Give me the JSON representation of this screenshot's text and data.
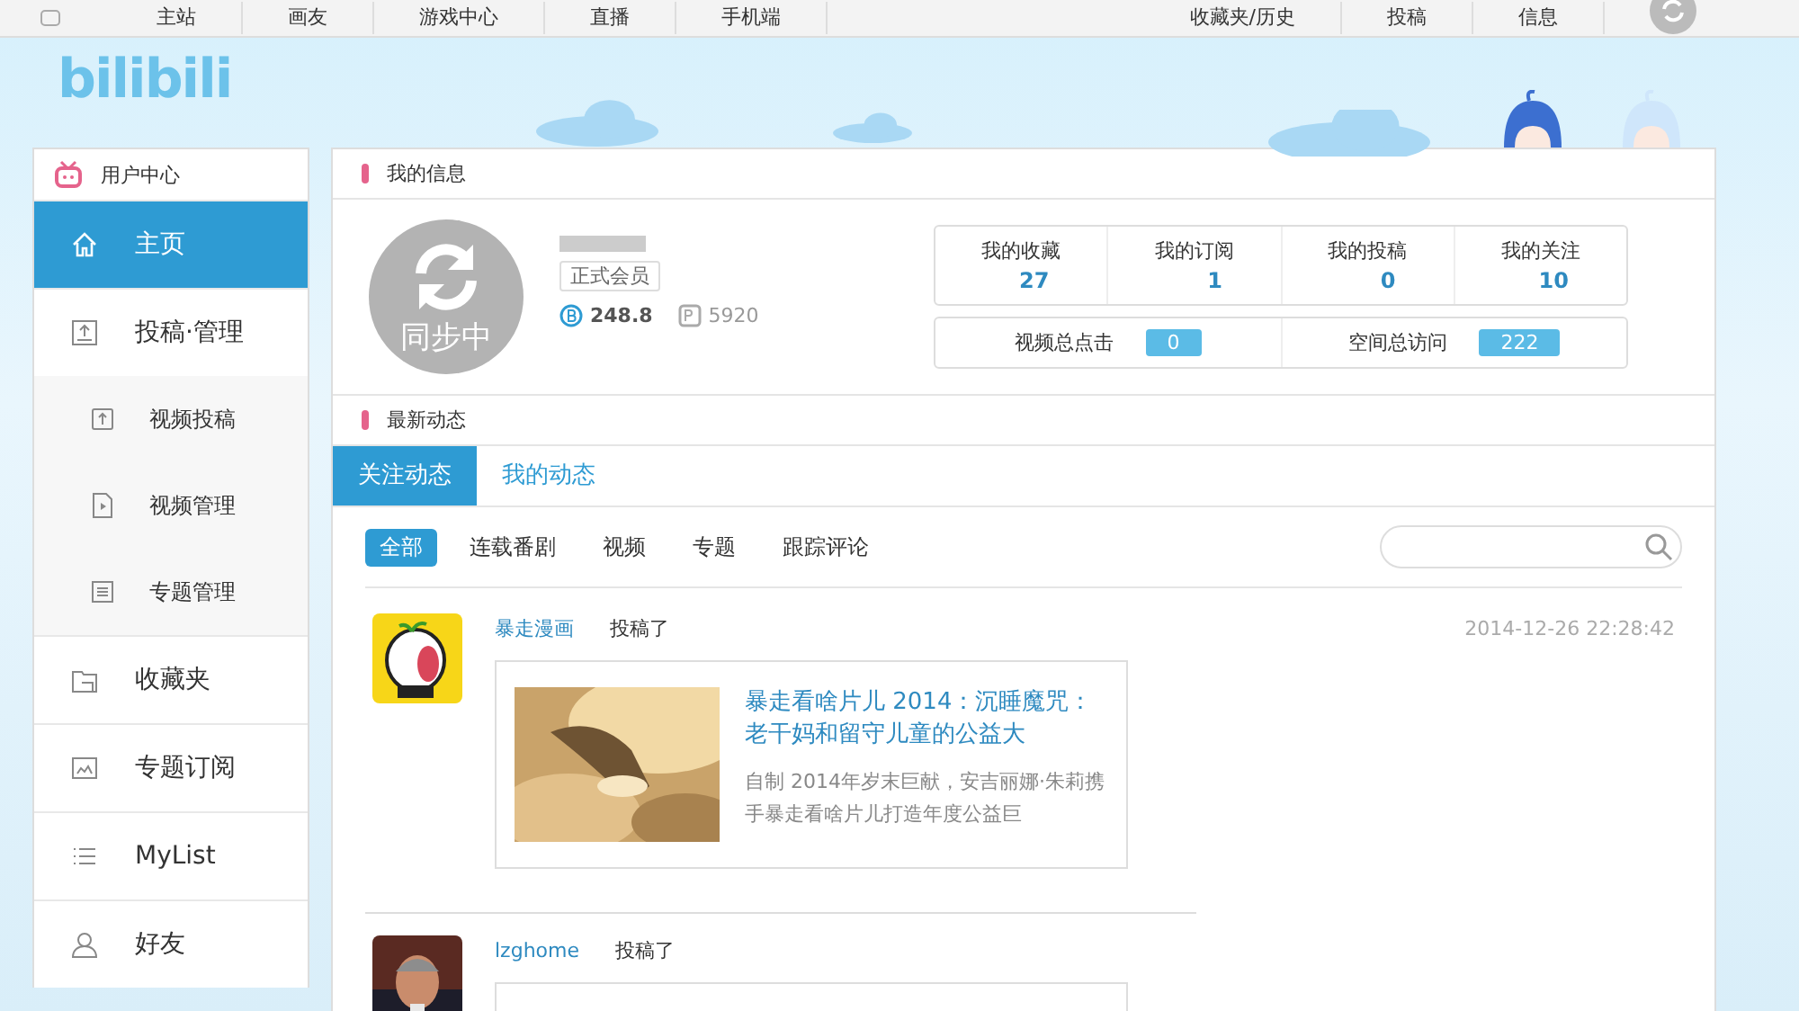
{
  "top_nav": {
    "left": [
      "主站",
      "画友",
      "游戏中心",
      "直播",
      "手机端"
    ],
    "right": [
      "收藏夹/历史",
      "投稿",
      "信息"
    ]
  },
  "logo": "bilibili",
  "sidebar": {
    "title": "用户中心",
    "items": [
      {
        "label": "主页",
        "kind": "main",
        "selected": true
      },
      {
        "label": "投稿·管理",
        "kind": "main",
        "selected": false
      },
      {
        "label": "视频投稿",
        "kind": "sub",
        "selected": false
      },
      {
        "label": "视频管理",
        "kind": "sub",
        "selected": false
      },
      {
        "label": "专题管理",
        "kind": "sub",
        "selected": false
      },
      {
        "label": "收藏夹",
        "kind": "main",
        "selected": false
      },
      {
        "label": "专题订阅",
        "kind": "main",
        "selected": false
      },
      {
        "label": "MyList",
        "kind": "main",
        "selected": false
      },
      {
        "label": "好友",
        "kind": "main",
        "selected": false
      }
    ]
  },
  "my_info": {
    "title": "我的信息",
    "avatar_text": "同步中",
    "member_badge": "正式会员",
    "coins": "248.8",
    "points": "5920",
    "stats": [
      {
        "label": "我的收藏",
        "value": "27"
      },
      {
        "label": "我的订阅",
        "value": "1"
      },
      {
        "label": "我的投稿",
        "value": "0"
      },
      {
        "label": "我的关注",
        "value": "10"
      }
    ],
    "totals": [
      {
        "label": "视频总点击",
        "value": "0"
      },
      {
        "label": "空间总访问",
        "value": "222"
      }
    ]
  },
  "activity": {
    "title": "最新动态",
    "tabs": [
      {
        "label": "关注动态",
        "selected": true
      },
      {
        "label": "我的动态",
        "selected": false
      }
    ],
    "filters": [
      {
        "label": "全部",
        "selected": true
      },
      {
        "label": "连载番剧",
        "selected": false
      },
      {
        "label": "视频",
        "selected": false
      },
      {
        "label": "专题",
        "selected": false
      },
      {
        "label": "跟踪评论",
        "selected": false
      }
    ],
    "feed": [
      {
        "author": "暴走漫画",
        "action": "投稿了",
        "time": "2014-12-26 22:28:42",
        "card": {
          "title": "暴走看啥片儿 2014：沉睡魔咒：老干妈和留守儿童的公益大",
          "description": "自制 2014年岁末巨献，安吉丽娜·朱莉携手暴走看啥片儿打造年度公益巨"
        }
      },
      {
        "author": "lzghome",
        "action": "投稿了"
      }
    ]
  }
}
